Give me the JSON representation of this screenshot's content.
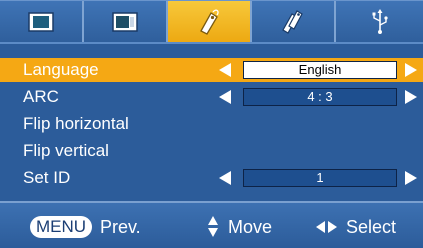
{
  "tabs": [
    {
      "icon": "picture-icon",
      "active": false
    },
    {
      "icon": "screen-icon",
      "active": false
    },
    {
      "icon": "special-tag-icon",
      "active": true
    },
    {
      "icon": "option-tags-icon",
      "active": false
    },
    {
      "icon": "usb-icon",
      "active": false
    }
  ],
  "menu": {
    "items": [
      {
        "label": "Language",
        "value": "English"
      },
      {
        "label": "ARC",
        "value": "4 : 3"
      },
      {
        "label": "Flip horizontal"
      },
      {
        "label": "Flip vertical"
      },
      {
        "label": "Set ID",
        "value": "1"
      }
    ]
  },
  "footer": {
    "menu_label": "MENU",
    "prev_label": "Prev.",
    "move_label": "Move",
    "select_label": "Select"
  },
  "colors": {
    "panel": "#2c5c9a",
    "highlight": "#f5a814",
    "value_box": "#1e4f8f",
    "text": "#ffffff"
  }
}
